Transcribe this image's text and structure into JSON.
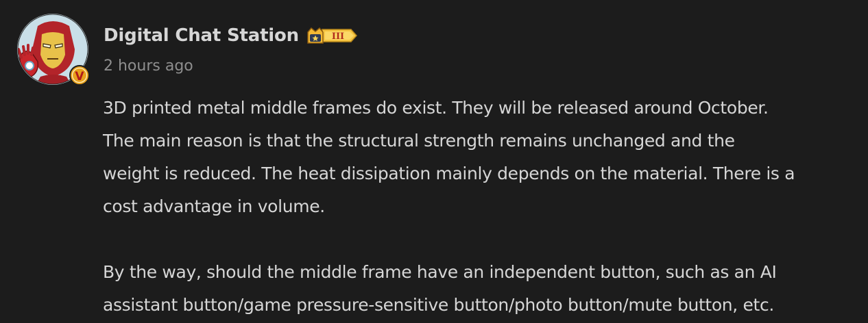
{
  "post": {
    "author": {
      "name": "Digital Chat Station",
      "verified_badge": "V",
      "level_badge": "III",
      "avatar_icon": "iron-man-avatar"
    },
    "timestamp": "2 hours ago",
    "paragraphs": [
      "3D printed metal middle frames do exist. They will be released around October.\nThe main reason is that the structural strength remains unchanged and the\nweight is reduced. The heat dissipation mainly depends on the material. There is a\ncost advantage in volume.",
      "By the way, should the middle frame have an independent button, such as an AI\nassistant button/game pressure-sensitive button/photo button/mute button, etc."
    ]
  },
  "colors": {
    "background": "#1c1c1c",
    "text": "#d6d6d6",
    "muted": "#8e8e8e",
    "badge_gold": "#f5c542",
    "verified_orange": "#f0a020"
  }
}
